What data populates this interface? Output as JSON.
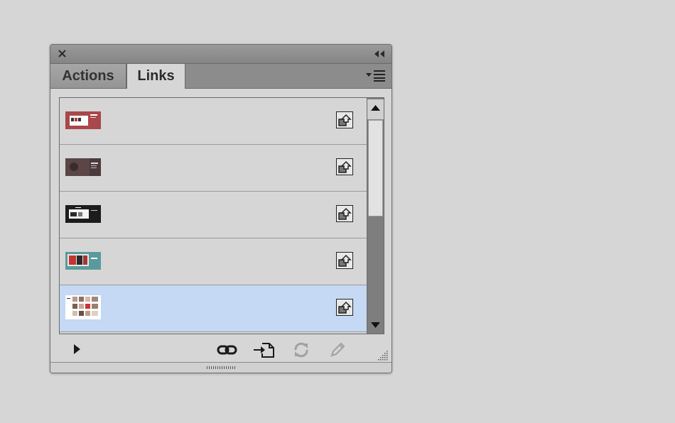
{
  "panel": {
    "tabs": [
      {
        "label": "Actions",
        "active": false
      },
      {
        "label": "Links",
        "active": true
      }
    ],
    "titlebar": {
      "close_icon": "close-icon",
      "collapse_icon": "double-chevron-left-icon"
    },
    "menu_icon": "panel-menu-icon"
  },
  "links_list": {
    "items": [
      {
        "thumbnail_palette": [
          "#a9474a",
          "#ffffff"
        ],
        "selected": false
      },
      {
        "thumbnail_palette": [
          "#4b3b3d",
          "#7a6a6c"
        ],
        "selected": false
      },
      {
        "thumbnail_palette": [
          "#1c1c1c",
          "#f2f2f2"
        ],
        "selected": false
      },
      {
        "thumbnail_palette": [
          "#5a9a9c",
          "#c3352d"
        ],
        "selected": false
      },
      {
        "thumbnail_palette": [
          "#ffffff",
          "#b89a8a"
        ],
        "selected": true
      }
    ],
    "selection_color": "#c5d8f4",
    "row_action_icon": "go-to-link-icon"
  },
  "footer": {
    "icons": [
      "expand-triangle-icon",
      "relink-icon",
      "place-link-icon",
      "update-link-icon",
      "edit-original-icon"
    ],
    "disabled": [
      "update-link-icon",
      "edit-original-icon"
    ]
  }
}
